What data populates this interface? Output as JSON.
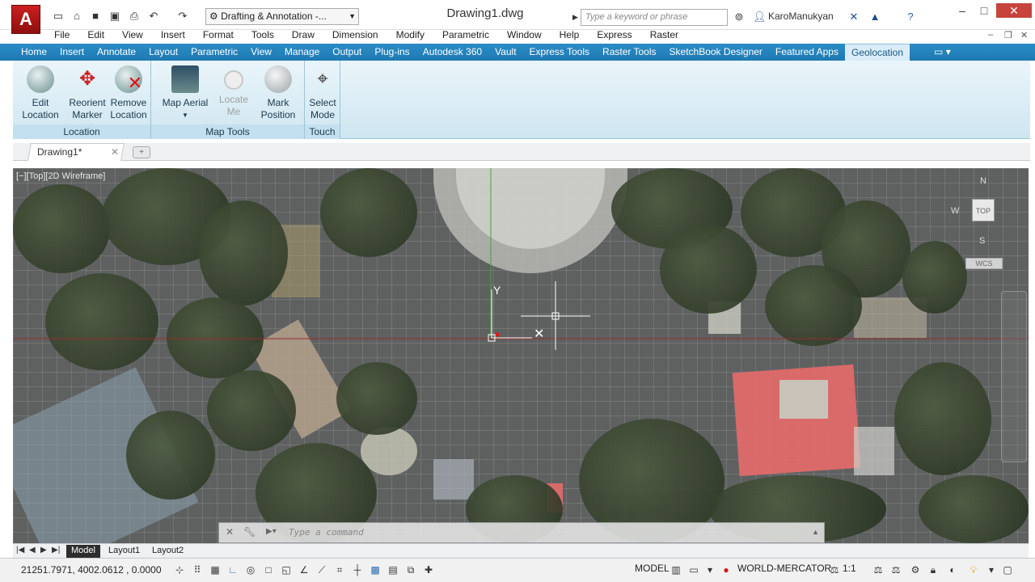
{
  "titlebar": {
    "workspace": "Drafting & Annotation -...",
    "document_title": "Drawing1.dwg",
    "search_placeholder": "Type a keyword or phrase",
    "user_name": "KaroManukyan"
  },
  "menubar": [
    "File",
    "Edit",
    "View",
    "Insert",
    "Format",
    "Tools",
    "Draw",
    "Dimension",
    "Modify",
    "Parametric",
    "Window",
    "Help",
    "Express",
    "Raster"
  ],
  "ribbon_tabs": [
    "Home",
    "Insert",
    "Annotate",
    "Layout",
    "Parametric",
    "View",
    "Manage",
    "Output",
    "Plug-ins",
    "Autodesk 360",
    "Vault",
    "Express Tools",
    "Raster Tools",
    "SketchBook Designer",
    "Featured Apps",
    "Geolocation"
  ],
  "active_ribbon_tab": "Geolocation",
  "ribbon": {
    "location": {
      "label": "Location",
      "edit_location": "Edit\nLocation",
      "reorient_marker": "Reorient\nMarker",
      "remove_location": "Remove\nLocation"
    },
    "map_tools": {
      "label": "Map Tools",
      "map_aerial": "Map Aerial",
      "locate_me": "Locate\nMe",
      "mark_position": "Mark\nPosition"
    },
    "touch": {
      "label": "Touch",
      "select_mode": "Select\nMode"
    }
  },
  "file_tab": {
    "label": "Drawing1*"
  },
  "viewport": {
    "label": "[−][Top][2D Wireframe]",
    "viewcube": {
      "north": "N",
      "south": "S",
      "west": "W",
      "top": "TOP",
      "wcs": "WCS"
    },
    "command_placeholder": "Type a command"
  },
  "layout_tabs": [
    "Model",
    "Layout1",
    "Layout2"
  ],
  "active_layout": "Model",
  "statusbar": {
    "coordinates": "21251.7971, 4002.0612 , 0.0000",
    "model": "MODEL",
    "coordinate_system": "WORLD-MERCATOR",
    "annotation_scale": "1:1"
  },
  "colors": {
    "ribbon_tab_bg": "#1f79b2",
    "logo_red": "#cc1f1f",
    "close_red": "#c7443c"
  }
}
